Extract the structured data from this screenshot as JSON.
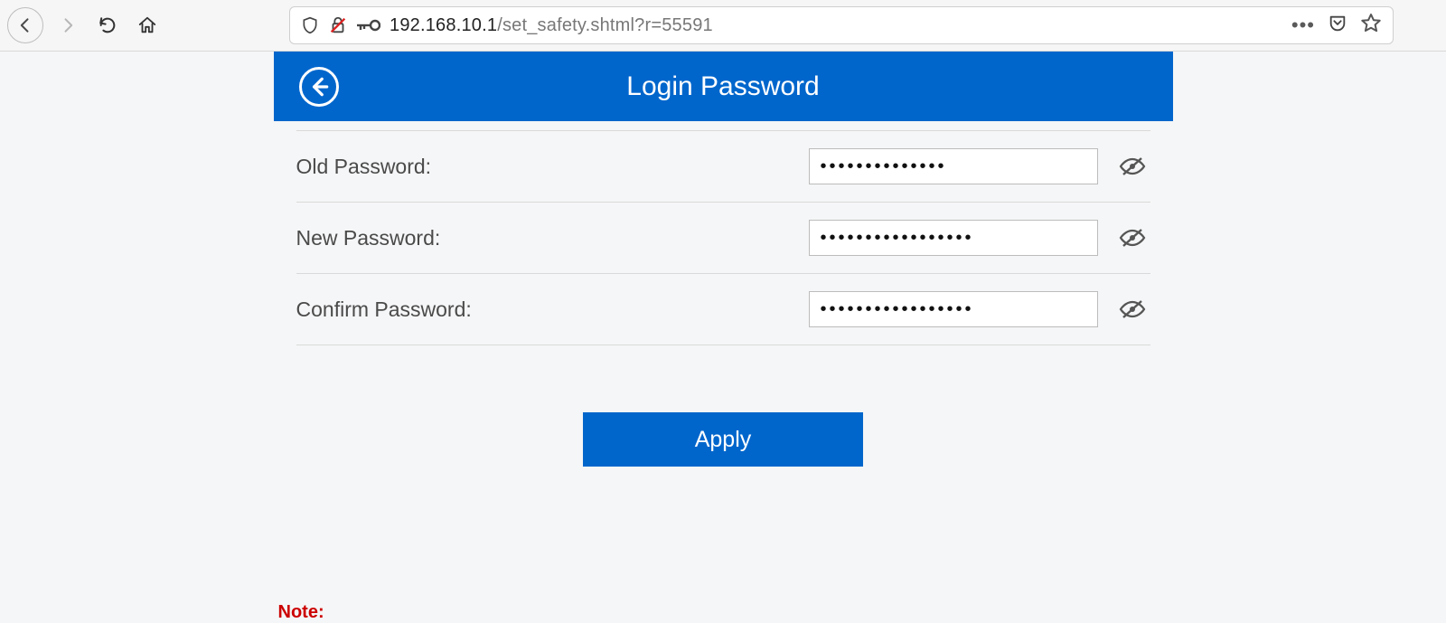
{
  "browser": {
    "url_host": "192.168.10.1",
    "url_path": "/set_safety.shtml?r=55591"
  },
  "header": {
    "title": "Login Password"
  },
  "form": {
    "old_label": "Old Password:",
    "old_value": "••••••••••••••",
    "new_label": "New Password:",
    "new_value": "•••••••••••••••••",
    "confirm_label": "Confirm Password:",
    "confirm_value": "•••••••••••••••••",
    "apply_label": "Apply"
  },
  "note": {
    "label": "Note:"
  }
}
